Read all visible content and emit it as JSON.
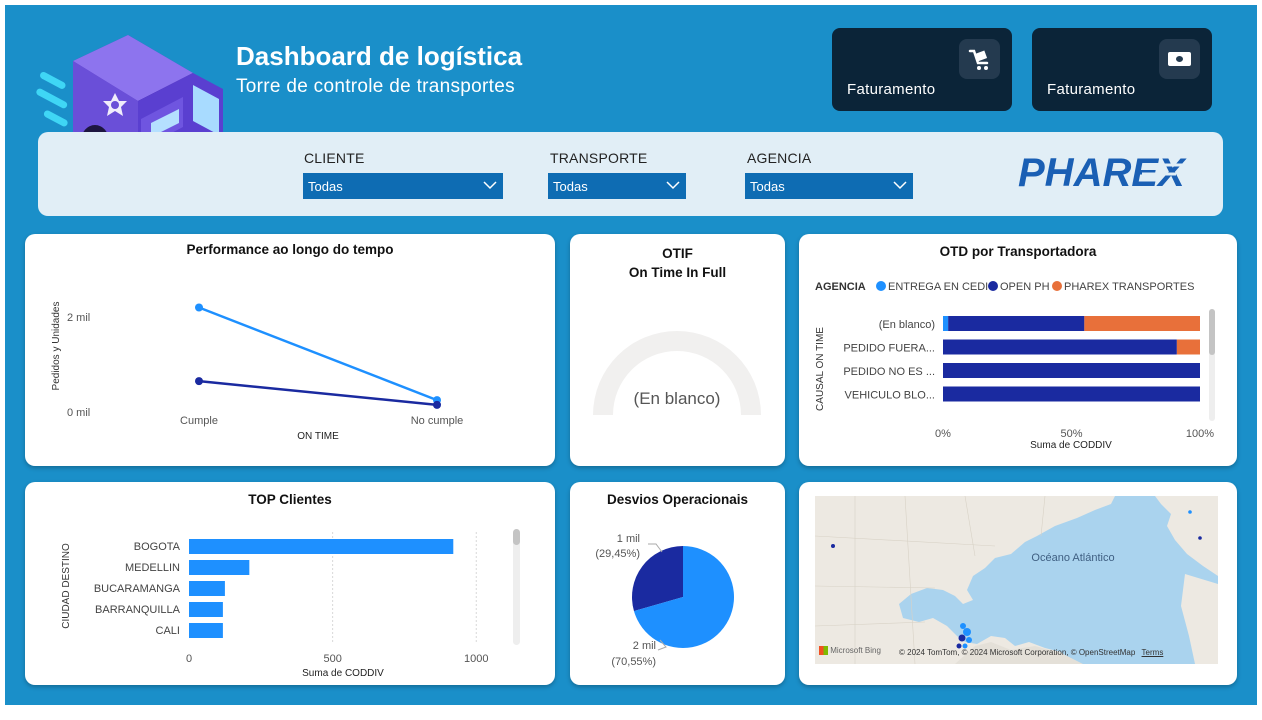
{
  "header": {
    "title": "Dashboard de logística",
    "subtitle": "Torre de controle de transportes"
  },
  "kpis": [
    {
      "label": "Faturamento",
      "icon": "cart-icon"
    },
    {
      "label": "Faturamento",
      "icon": "money-icon"
    }
  ],
  "filters": [
    {
      "label": "CLIENTE",
      "value": "Todas"
    },
    {
      "label": "TRANSPORTE",
      "value": "Todas"
    },
    {
      "label": "AGENCIA",
      "value": "Todas"
    }
  ],
  "logo_text": "PHAREX",
  "colors": {
    "background": "#1a8fc9",
    "series_light": "#1e90ff",
    "series_dark": "#1a2aa0",
    "series_orange": "#e8703a",
    "slicer": "#0e6cb3"
  },
  "performance": {
    "title": "Performance ao longo do tempo",
    "chart_data": {
      "type": "line",
      "categories": [
        "Cumple",
        "No cumple"
      ],
      "series": [
        {
          "name": "",
          "values": [
            2200,
            250
          ]
        },
        {
          "name": "",
          "values": [
            650,
            150
          ]
        }
      ],
      "ylim": [
        0,
        2800
      ],
      "yticks": [
        "2 mil",
        "0 mil"
      ],
      "xlabel": "ON TIME",
      "ylabel": "Pedidos y Unidades"
    }
  },
  "otif": {
    "title": "OTIF",
    "subtitle": "On Time In Full",
    "center_text": "(En blanco)",
    "chart_data": {
      "type": "gauge",
      "value": 0
    }
  },
  "otd": {
    "title": "OTD  por Transportadora",
    "legend_title": "AGENCIA",
    "chart_data": {
      "type": "bar",
      "categories": [
        "(En blanco)",
        "PEDIDO FUERA...",
        "PEDIDO NO ES ...",
        "VEHICULO BLO..."
      ],
      "series": [
        {
          "name": "ENTREGA EN CEDI",
          "values": [
            2,
            0,
            0,
            0
          ]
        },
        {
          "name": "OPEN PH",
          "values": [
            53,
            91,
            100,
            100
          ]
        },
        {
          "name": "PHAREX TRANSPORTES",
          "values": [
            45,
            9,
            0,
            0
          ]
        }
      ],
      "xticks": [
        "0%",
        "50%",
        "100%"
      ],
      "xlabel": "Suma de CODDIV",
      "ylabel": "CAUSAL ON TIME"
    }
  },
  "top_clients": {
    "title": "TOP Clientes",
    "chart_data": {
      "type": "bar",
      "categories": [
        "BOGOTA",
        "MEDELLIN",
        "BUCARAMANGA",
        "BARRANQUILLA",
        "CALI"
      ],
      "values": [
        920,
        210,
        125,
        118,
        118
      ],
      "xlim": [
        0,
        1100
      ],
      "xticks": [
        "0",
        "500",
        "1000"
      ],
      "xlabel": "Suma de CODDIV",
      "ylabel": "CIUDAD DESTINO"
    }
  },
  "desvios": {
    "title": "Desvios Operacionais",
    "chart_data": {
      "type": "pie",
      "slices": [
        {
          "label": "1 mil",
          "pct_label": "(29,45%)",
          "value": 29.45
        },
        {
          "label": "2 mil",
          "pct_label": "(70,55%)",
          "value": 70.55
        }
      ]
    }
  },
  "map": {
    "ocean_label": "Océano Atlántico",
    "attribution": "© 2024 TomTom, © 2024 Microsoft Corporation, © OpenStreetMap",
    "terms": "Terms",
    "brand": "Microsoft Bing"
  }
}
